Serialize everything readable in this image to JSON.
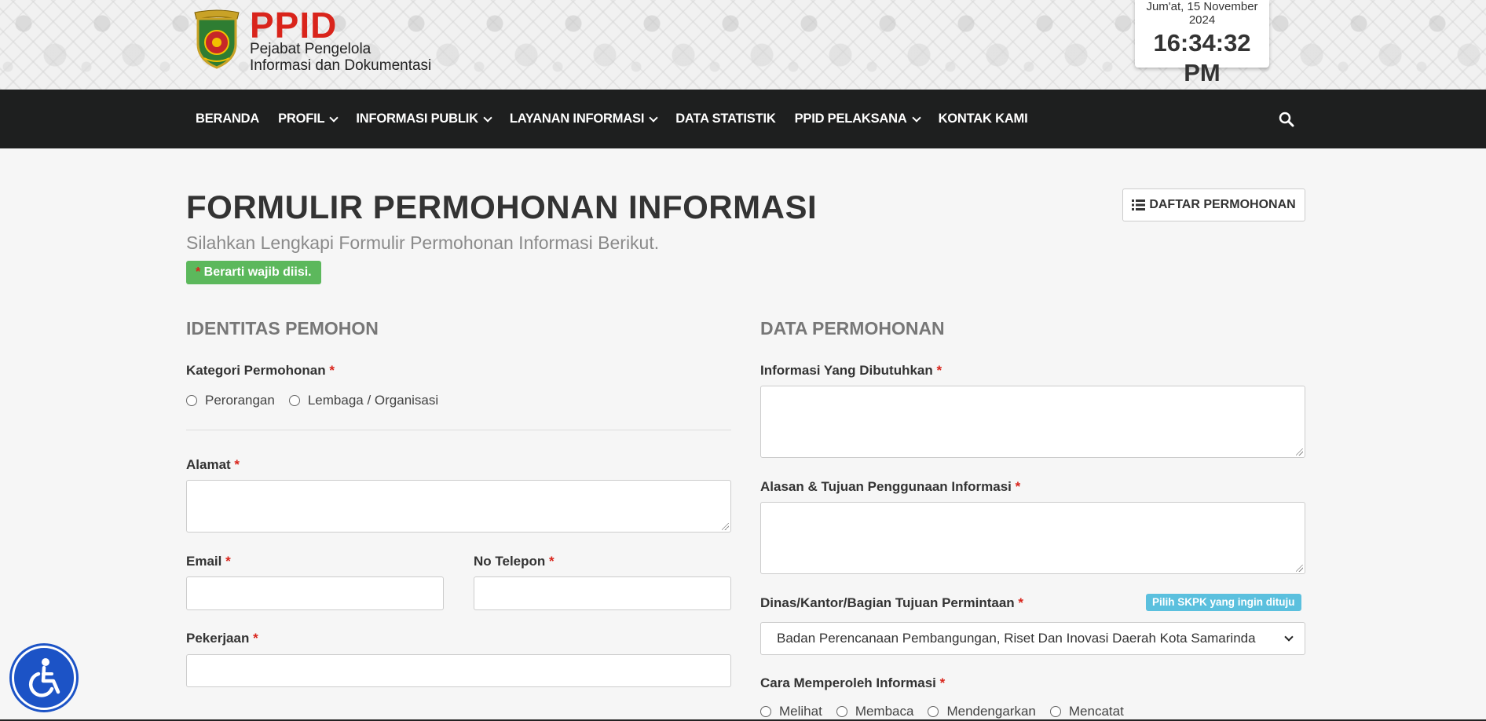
{
  "header": {
    "brand_title": "PPID",
    "brand_sub1": "Pejabat Pengelola",
    "brand_sub2": "Informasi dan Dokumentasi",
    "clock_date": "Jum'at, 15 November 2024",
    "clock_time": "16:34:32 PM"
  },
  "nav": {
    "items": [
      {
        "label": "BERANDA",
        "dropdown": false
      },
      {
        "label": "PROFIL",
        "dropdown": true
      },
      {
        "label": "INFORMASI PUBLIK",
        "dropdown": true
      },
      {
        "label": "LAYANAN INFORMASI",
        "dropdown": true
      },
      {
        "label": "DATA STATISTIK",
        "dropdown": false
      },
      {
        "label": "PPID PELAKSANA",
        "dropdown": true
      },
      {
        "label": "KONTAK KAMI",
        "dropdown": false
      }
    ],
    "search_icon": "search-icon"
  },
  "page": {
    "title": "FORMULIR PERMOHONAN INFORMASI",
    "subtitle": "Silahkan Lengkapi Formulir Permohonan Informasi Berikut.",
    "required_badge_star": "*",
    "required_badge_text": " Berarti wajib diisi.",
    "list_button": "DAFTAR PERMOHONAN"
  },
  "identitas": {
    "section_title": "IDENTITAS PEMOHON",
    "kategori_label": "Kategori Permohonan",
    "kategori_options": [
      "Perorangan",
      "Lembaga / Organisasi"
    ],
    "alamat_label": "Alamat",
    "email_label": "Email",
    "telepon_label": "No Telepon",
    "pekerjaan_label": "Pekerjaan"
  },
  "permohonan": {
    "section_title": "DATA PERMOHONAN",
    "informasi_label": "Informasi Yang Dibutuhkan",
    "alasan_label": "Alasan & Tujuan Penggunaan Informasi",
    "dinas_label": "Dinas/Kantor/Bagian Tujuan Permintaan",
    "skpk_badge": "Pilih SKPK yang ingin dituju",
    "dinas_selected": "Badan Perencanaan Pembangungan, Riset Dan Inovasi Daerah Kota Samarinda",
    "cara_label": "Cara Memperoleh Informasi",
    "cara_options": [
      "Melihat",
      "Membaca",
      "Mendengarkan",
      "Mencatat"
    ]
  },
  "required_mark": "*",
  "colors": {
    "brand_red": "#d9241b",
    "navbar_bg": "#1e1f1f",
    "success_green": "#5cb85c",
    "info_blue": "#5bc0de",
    "a11y_blue": "#1c53c6"
  }
}
